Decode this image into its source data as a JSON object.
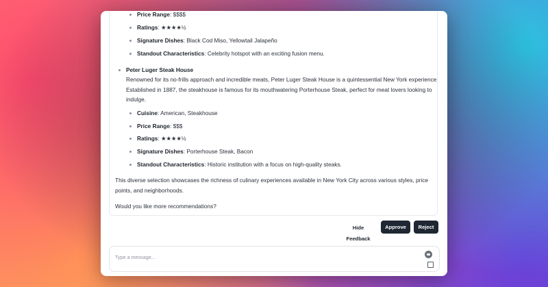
{
  "first_restaurant": {
    "price_range_label": "Price Range",
    "price_range_value": ": $$$$",
    "ratings_label": "Ratings",
    "ratings_value": ": ★★★★½",
    "signature_label": "Signature Dishes",
    "signature_value": ": Black Cod Miso, Yellowtail Jalapeño",
    "standout_label": "Standout Characteristics",
    "standout_value": ": Celebrity hotspot with an exciting fusion menu."
  },
  "second_restaurant": {
    "name": "Peter Luger Steak House",
    "description_lines": [
      "Renowned for its no-frills approach and incredible meats, Peter Luger Steak House is a quintessential New York experience.",
      "Established in 1887, the steakhouse is famous for its mouthwatering Porterhouse Steak, perfect for meat lovers looking to",
      "indulge."
    ],
    "cuisine_label": "Cuisine",
    "cuisine_value": ": American, Steakhouse",
    "price_range_label": "Price Range",
    "price_range_value": ": $$$",
    "ratings_label": "Ratings",
    "ratings_value": ": ★★★★½",
    "signature_label": "Signature Dishes",
    "signature_value": ": Porterhouse Steak, Bacon",
    "standout_label": "Standout Characteristics",
    "standout_value": ": Historic institution with a focus on high-quality steaks."
  },
  "summary_lines": [
    "This diverse selection showcases the richness of culinary experiences available in New York City across various styles, price",
    "points, and neighborhoods."
  ],
  "closing_question": "Would you like more recommendations?",
  "actions": {
    "hide_feedback": "Hide Feedback",
    "approve": "Approve",
    "reject": "Reject"
  },
  "composer": {
    "placeholder": "Type a message..."
  },
  "colors": {
    "button_dark": "#1f2733",
    "text_primary": "#2a2f38"
  }
}
